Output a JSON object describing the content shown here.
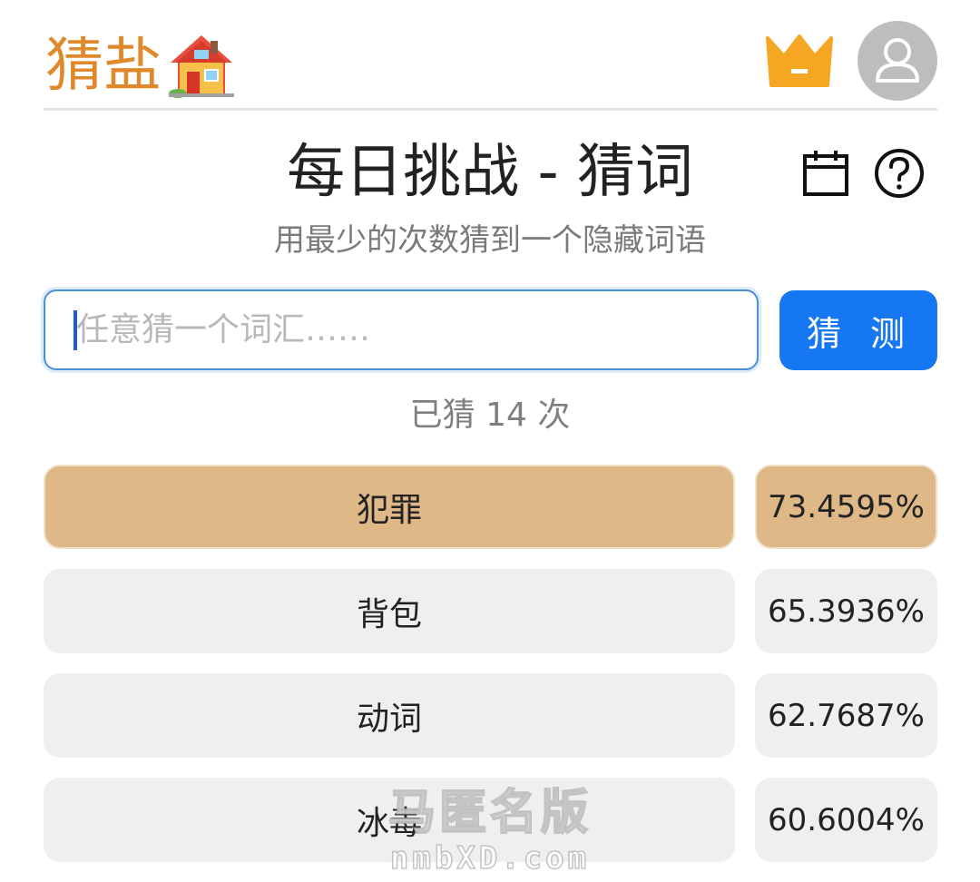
{
  "header": {
    "brand": "猜盐",
    "brand_color": "#e0892b",
    "icons": [
      "house-icon",
      "crown-icon",
      "user-avatar-icon"
    ]
  },
  "main": {
    "title": "每日挑战 - 猜词",
    "subtitle": "用最少的次数猜到一个隐藏词语",
    "icons": [
      "calendar-icon",
      "help-icon"
    ],
    "input": {
      "placeholder": "任意猜一个词汇……",
      "value": ""
    },
    "guess_button": "猜 测",
    "guess_count_text": "已猜 14 次",
    "accent_color": "#1677f2",
    "highlight_color": "#deb887"
  },
  "guesses": [
    {
      "word": "犯罪",
      "score": "73.4595%",
      "highlight": true
    },
    {
      "word": "背包",
      "score": "65.3936%",
      "highlight": false
    },
    {
      "word": "动词",
      "score": "62.7687%",
      "highlight": false
    },
    {
      "word": "冰毒",
      "score": "60.6004%",
      "highlight": false
    }
  ],
  "watermark": {
    "main": "马匿名版",
    "sub": "nmbXD.com"
  }
}
